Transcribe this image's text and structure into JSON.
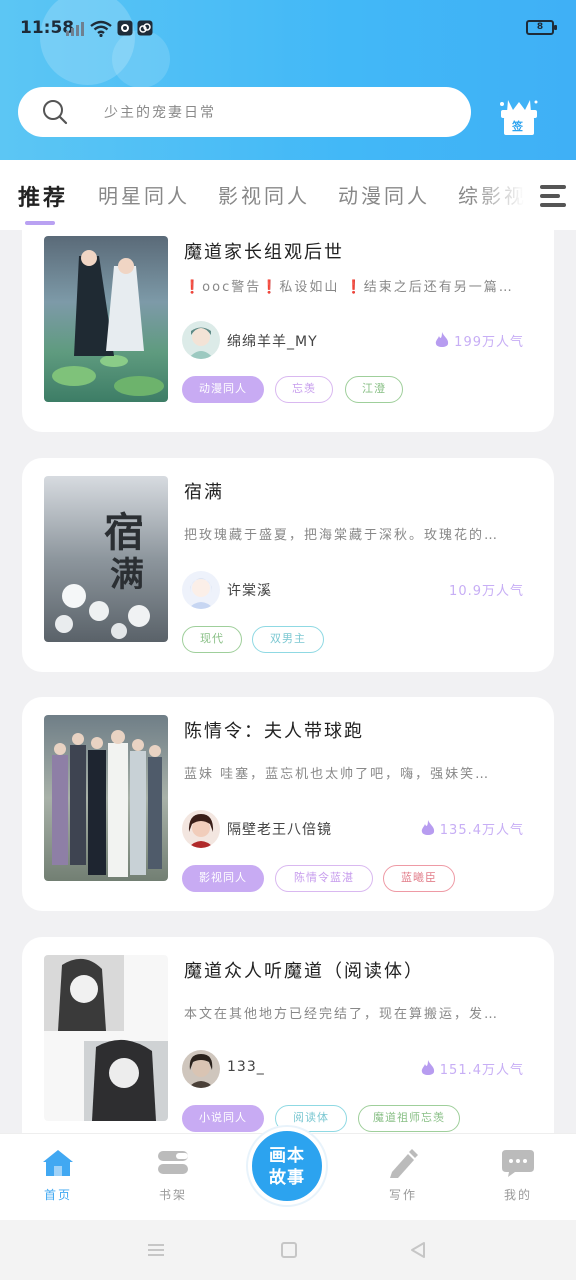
{
  "status_bar": {
    "time": "11:58",
    "battery": "8"
  },
  "search": {
    "placeholder": "少主的宠妻日常"
  },
  "gift_badge": "签",
  "tabs": [
    {
      "label": "推荐",
      "active": true
    },
    {
      "label": "明星同人"
    },
    {
      "label": "影视同人"
    },
    {
      "label": "动漫同人"
    },
    {
      "label": "综影视"
    }
  ],
  "feed": [
    {
      "title": "魔道家长组观后世",
      "desc": "❗ooc警告❗私设如山 ❗结束之后还有另一篇…",
      "author": "绵绵羊羊_MY",
      "popularity": "199万人气",
      "tags": [
        "动漫同人",
        "忘羡",
        "江澄"
      ]
    },
    {
      "title": "宿满",
      "desc": "把玫瑰藏于盛夏，把海棠藏于深秋。玫瑰花的…",
      "author": "许棠溪",
      "popularity": "10.9万人气",
      "tags": [
        "现代",
        "双男主"
      ]
    },
    {
      "title": "陈情令：夫人带球跑",
      "desc": "蓝妹 哇塞，蓝忘机也太帅了吧，嗨，强妹笑…",
      "author": "隔壁老王八倍镜",
      "popularity": "135.4万人气",
      "tags": [
        "影视同人",
        "陈情令蓝湛",
        "蓝曦臣"
      ]
    },
    {
      "title": "魔道众人听魔道（阅读体）",
      "desc": "本文在其他地方已经完结了，现在算搬运，发…",
      "author": "133_",
      "popularity": "151.4万人气",
      "tags": [
        "小说同人",
        "阅读体",
        "魔道祖师忘羡"
      ]
    }
  ],
  "bottom_nav": [
    {
      "label": "首页",
      "active": true
    },
    {
      "label": "书架"
    },
    {
      "label": "写作"
    },
    {
      "label": "我的"
    }
  ],
  "center_button": {
    "line1": "画本",
    "line2": "故事"
  },
  "colors": {
    "header": "#42b8f7",
    "accent": "#c8abf3",
    "nav_active": "#41a8f2"
  }
}
